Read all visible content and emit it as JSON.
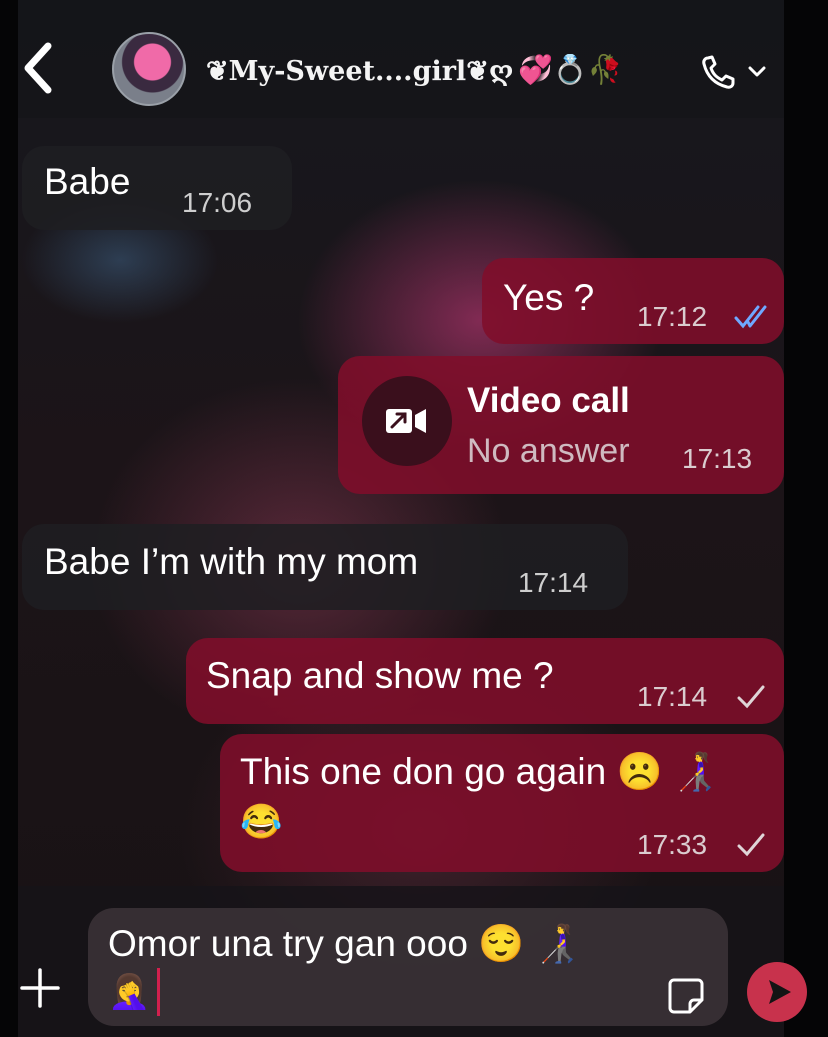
{
  "header": {
    "contact_name": "❦My-Sweet....girl❦ღ",
    "contact_emojis": "💞💍🥀",
    "back_icon": "chevron-left-icon",
    "call_icon": "phone-icon"
  },
  "messages": [
    {
      "direction": "incoming",
      "text": "Babe",
      "time": "17:06"
    },
    {
      "direction": "outgoing",
      "text": "Yes ?",
      "time": "17:12",
      "status": "read"
    },
    {
      "direction": "outgoing",
      "type": "video-call",
      "title": "Video call",
      "subtitle": "No answer",
      "time": "17:13"
    },
    {
      "direction": "incoming",
      "text": "Babe I’m with my mom",
      "time": "17:14"
    },
    {
      "direction": "outgoing",
      "text": "Snap and show me ?",
      "time": "17:14",
      "status": "sent"
    },
    {
      "direction": "outgoing",
      "text": "This one don go again ☹️ 👩‍🦯",
      "text_line2": "😂",
      "time": "17:33",
      "status": "sent"
    }
  ],
  "composer": {
    "value_line1": "Omor una try gan ooo 😌 👩‍🦯",
    "value_line2": "🤦‍♀️",
    "plus_icon": "plus-icon",
    "sticker_icon": "sticker-icon",
    "send_icon": "send-icon"
  },
  "colors": {
    "outgoing_bubble": "#800e2a",
    "incoming_bubble": "#1e1e22",
    "read_tick": "#6fa8ff",
    "send_button": "#c8324c"
  }
}
